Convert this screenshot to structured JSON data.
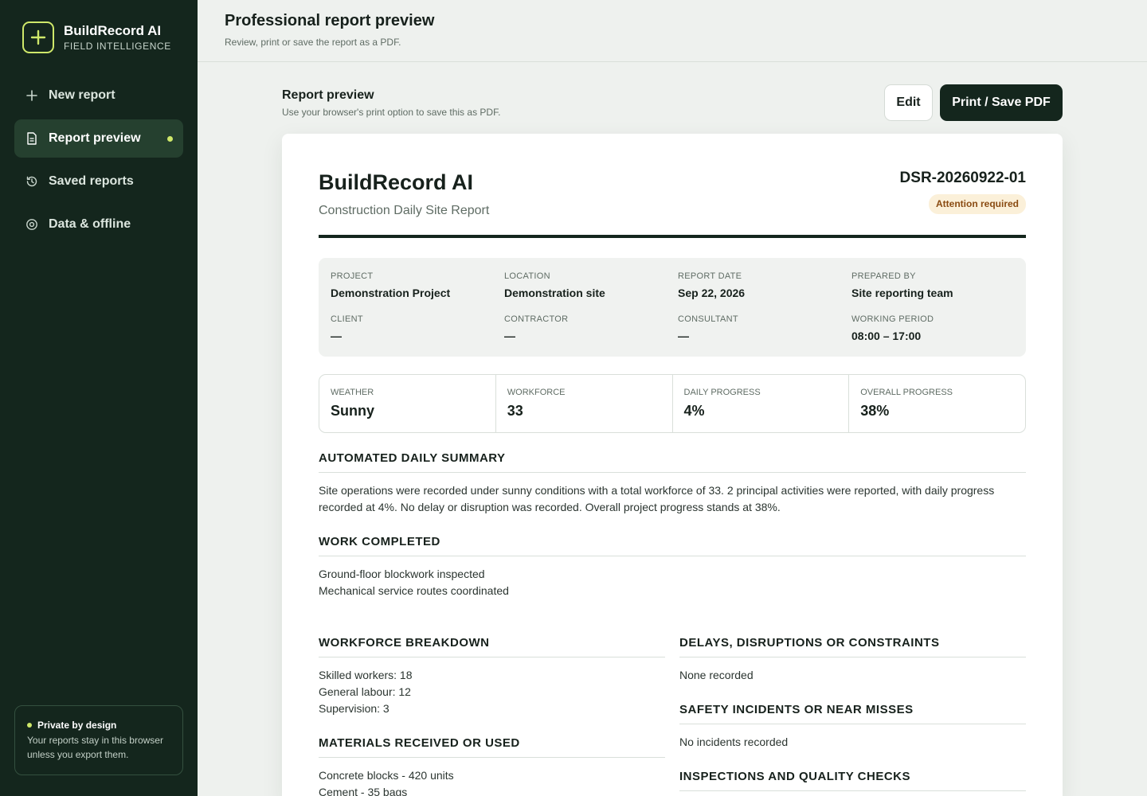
{
  "sidebar": {
    "brand_name": "BuildRecord AI",
    "brand_tag": "FIELD INTELLIGENCE",
    "items": [
      {
        "label": "New report",
        "icon": "plus-icon"
      },
      {
        "label": "Report preview",
        "icon": "document-icon",
        "active": true
      },
      {
        "label": "Saved reports",
        "icon": "history-icon"
      },
      {
        "label": "Data & offline",
        "icon": "gear-icon"
      }
    ],
    "privacy": {
      "title": "Private by design",
      "text": "Your reports stay in this browser unless you export them."
    }
  },
  "header": {
    "title": "Professional report preview",
    "subtitle": "Review, print or save the report as a PDF."
  },
  "preview": {
    "title": "Report preview",
    "subtitle": "Use your browser's print option to save this as PDF.",
    "edit_label": "Edit",
    "print_label": "Print / Save PDF"
  },
  "report": {
    "brand": "BuildRecord AI",
    "type": "Construction Daily Site Report",
    "id": "DSR-20260922-01",
    "badge": "Attention required",
    "meta": [
      {
        "label": "Project",
        "value": "Demonstration Project"
      },
      {
        "label": "Location",
        "value": "Demonstration site"
      },
      {
        "label": "Report date",
        "value": "Sep 22, 2026"
      },
      {
        "label": "Prepared by",
        "value": "Site reporting team"
      },
      {
        "label": "Client",
        "value": "—"
      },
      {
        "label": "Contractor",
        "value": "—"
      },
      {
        "label": "Consultant",
        "value": "—"
      },
      {
        "label": "Working period",
        "value": "08:00 – 17:00"
      }
    ],
    "stats": [
      {
        "label": "Weather",
        "value": "Sunny"
      },
      {
        "label": "Workforce",
        "value": "33"
      },
      {
        "label": "Daily progress",
        "value": "4%"
      },
      {
        "label": "Overall progress",
        "value": "38%"
      }
    ],
    "summary": {
      "heading": "Automated daily summary",
      "text": "Site operations were recorded under sunny conditions with a total workforce of 33. 2 principal activities were reported, with daily progress recorded at 4%. No delay or disruption was recorded. Overall project progress stands at 38%."
    },
    "work_completed": {
      "heading": "Work completed",
      "items": [
        "Ground-floor blockwork inspected",
        "Mechanical service routes coordinated"
      ]
    },
    "workforce_breakdown": {
      "heading": "Workforce breakdown",
      "items": [
        "Skilled workers: 18",
        "General labour: 12",
        "Supervision: 3"
      ]
    },
    "materials": {
      "heading": "Materials received or used",
      "items": [
        "Concrete blocks - 420 units",
        "Cement - 35 bags"
      ]
    },
    "delays": {
      "heading": "Delays, disruptions or constraints",
      "items": [
        "None recorded"
      ]
    },
    "safety": {
      "heading": "Safety incidents or near misses",
      "items": [
        "No incidents recorded"
      ]
    },
    "inspections": {
      "heading": "Inspections and quality checks",
      "items": []
    }
  },
  "colors": {
    "sidebar_bg": "#14261d",
    "accent": "#cfe86a",
    "badge_bg": "#fbf0d9",
    "badge_text": "#8a4b12"
  }
}
